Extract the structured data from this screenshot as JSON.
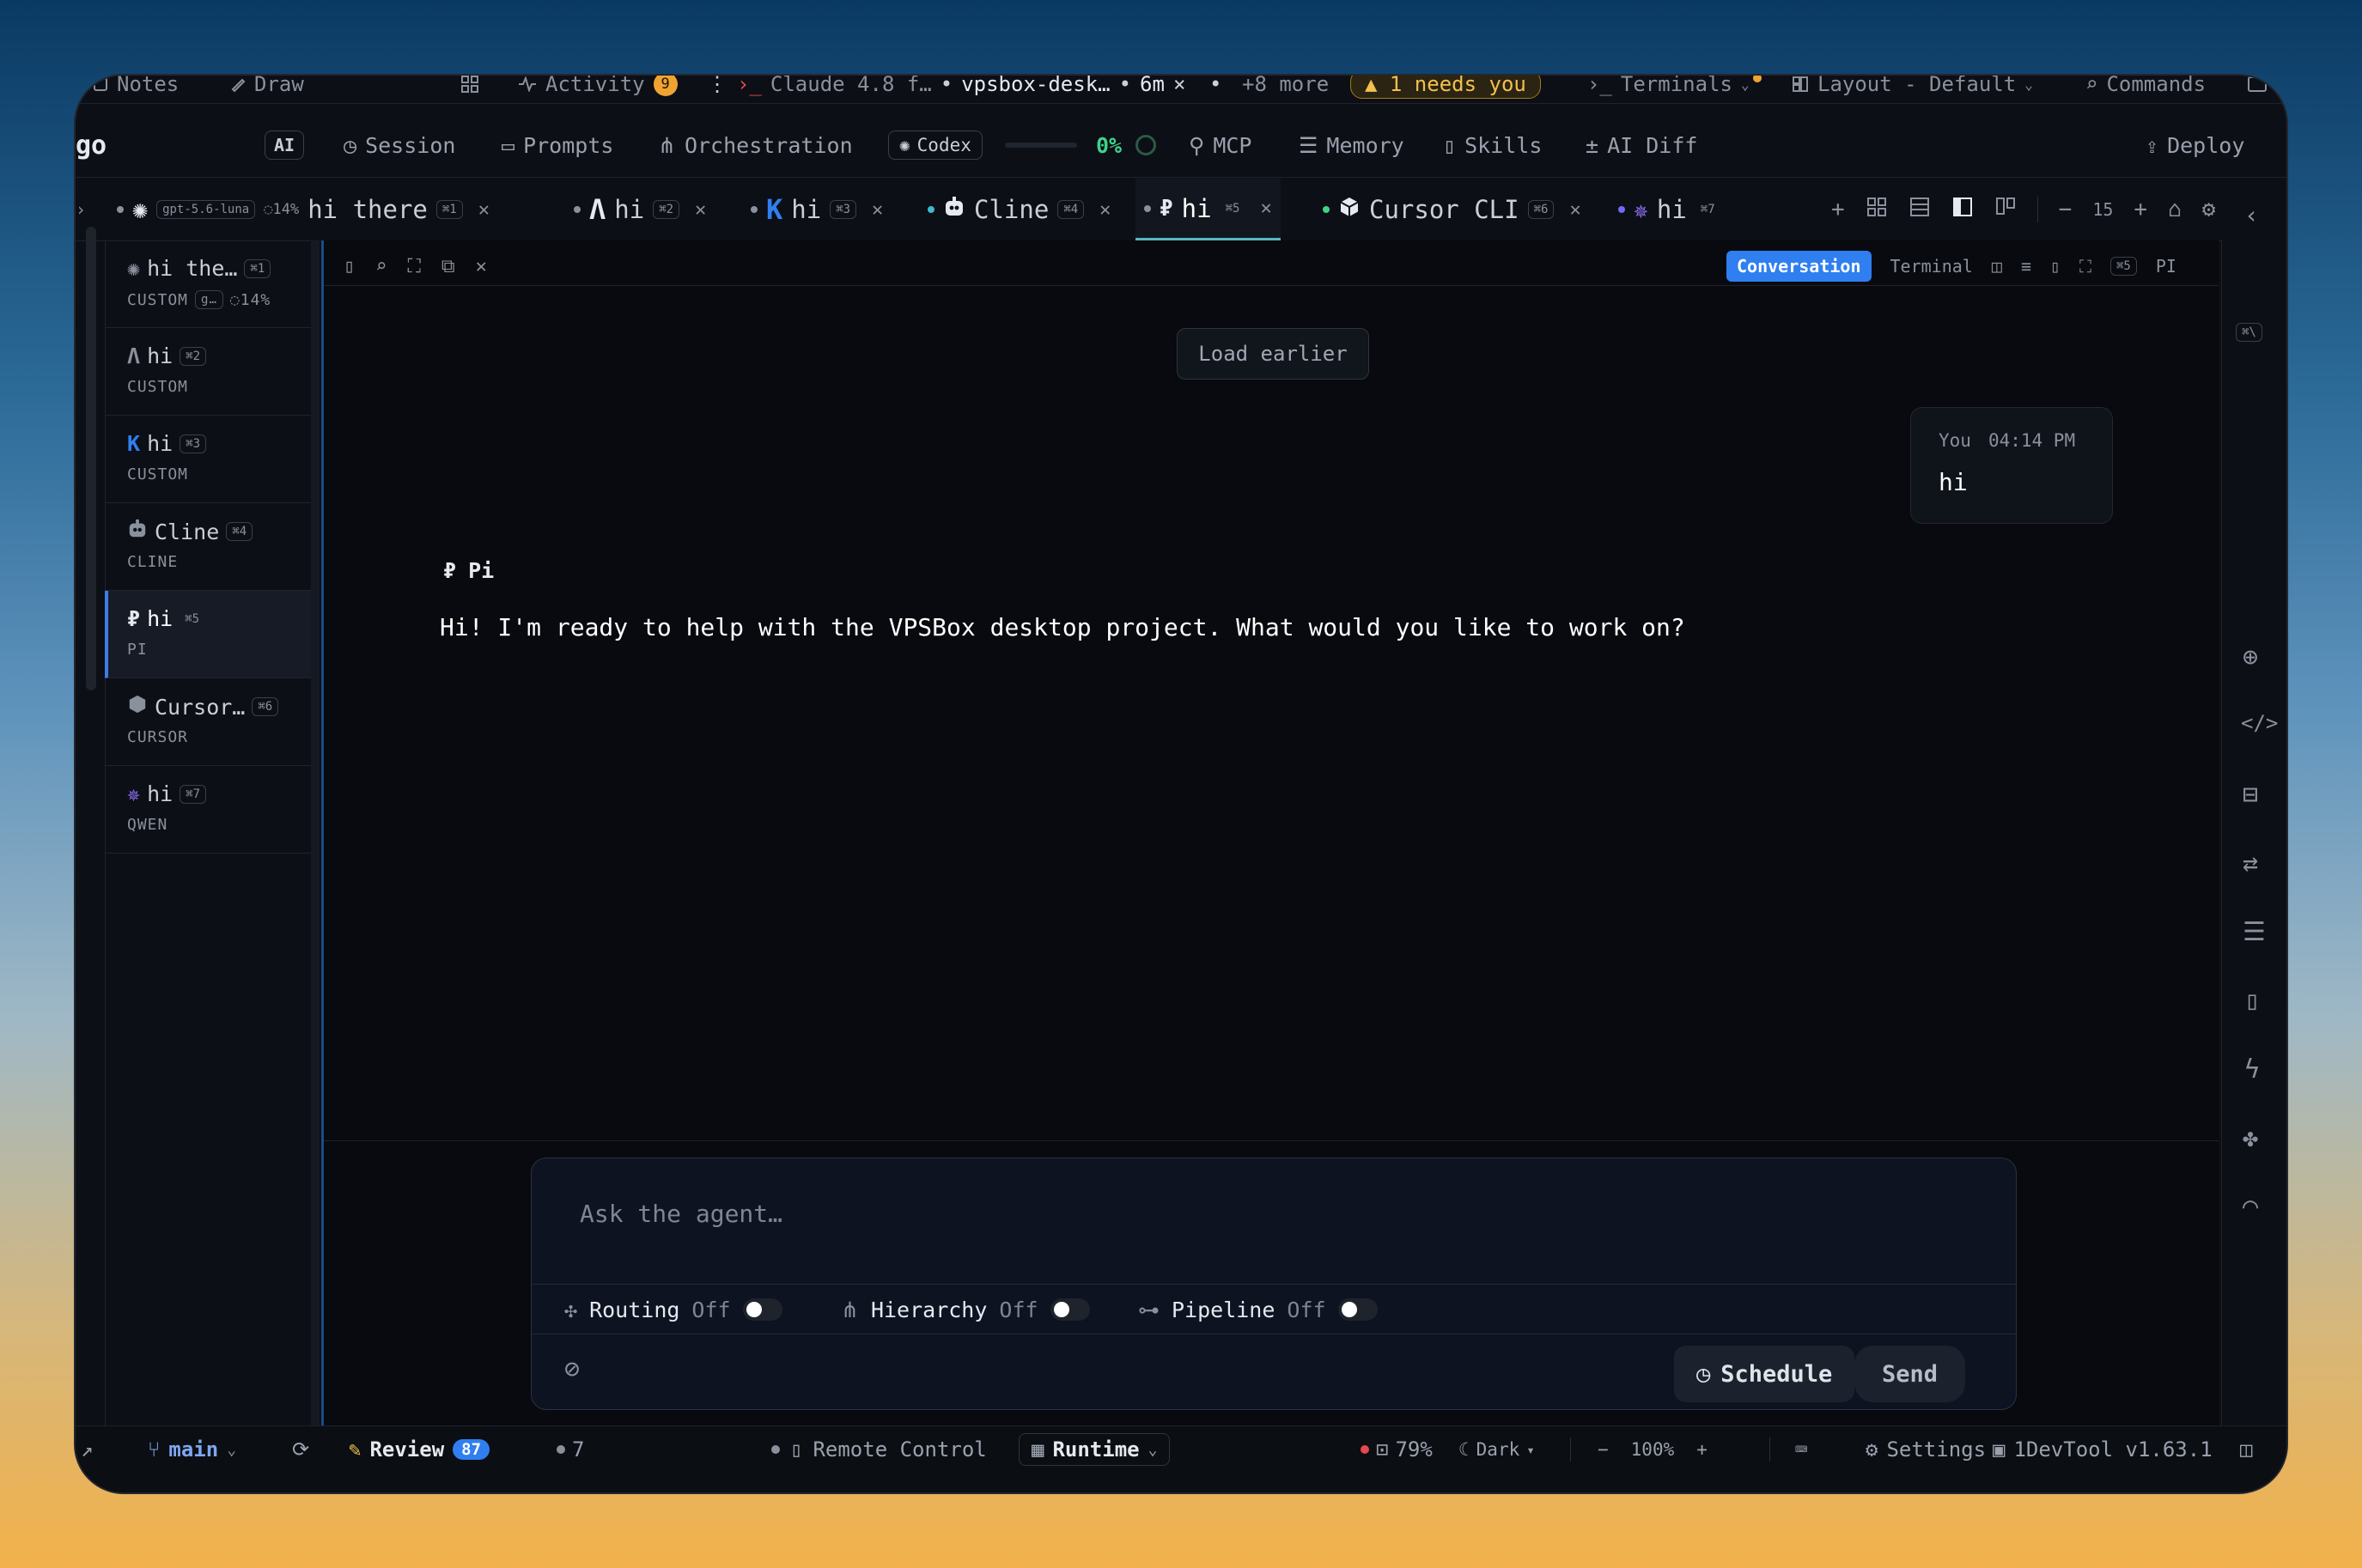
{
  "topbar": {
    "notes": "Notes",
    "draw": "Draw",
    "activity": "Activity",
    "activity_count": "9",
    "claude_session": "Claude 4.8 f…",
    "project": "vpsbox-desk…",
    "elapsed": "6m",
    "more": "+8 more",
    "needs_you": "1 needs you",
    "terminals": "Terminals",
    "layout": "Layout - Default",
    "commands": "Commands"
  },
  "nav": {
    "app_fragment": "go",
    "ai_badge": "AI",
    "session": "Session",
    "prompts": "Prompts",
    "orchestration": "Orchestration",
    "codex": "Codex",
    "progress": "0%",
    "mcp": "MCP",
    "memory": "Memory",
    "skills": "Skills",
    "ai_diff": "AI Diff",
    "deploy": "Deploy"
  },
  "tabs": [
    {
      "model": "gpt-5.6-luna",
      "progress": "14%",
      "label": "hi there",
      "shortcut": "⌘1"
    },
    {
      "label": "hi",
      "shortcut": "⌘2"
    },
    {
      "label": "hi",
      "shortcut": "⌘3"
    },
    {
      "label": "Cline",
      "shortcut": "⌘4"
    },
    {
      "label": "hi",
      "shortcut": "⌘5"
    },
    {
      "label": "Cursor CLI",
      "shortcut": "⌘6"
    },
    {
      "label": "hi",
      "shortcut": "⌘7"
    }
  ],
  "tab_controls": {
    "add": "+",
    "minus": "−",
    "font_size": "15",
    "plus": "+"
  },
  "sidebar": {
    "items": [
      {
        "title": "hi the…",
        "shortcut": "⌘1",
        "sub": "CUSTOM",
        "model": "g…",
        "progress": "14%"
      },
      {
        "title": "hi",
        "shortcut": "⌘2",
        "sub": "CUSTOM"
      },
      {
        "title": "hi",
        "shortcut": "⌘3",
        "sub": "CUSTOM"
      },
      {
        "title": "Cline",
        "shortcut": "⌘4",
        "sub": "CLINE"
      },
      {
        "title": "hi",
        "shortcut": "⌘5",
        "sub": "PI"
      },
      {
        "title": "Cursor…",
        "shortcut": "⌘6",
        "sub": "CURSOR"
      },
      {
        "title": "hi",
        "shortcut": "⌘7",
        "sub": "QWEN"
      }
    ]
  },
  "chat_toolbar": {
    "conversation": "Conversation",
    "terminal": "Terminal",
    "shortcut": "⌘5",
    "agent": "PI",
    "side_shortcut": "⌘\\"
  },
  "chat": {
    "load_earlier": "Load earlier",
    "user_name": "You",
    "user_time": "04:14 PM",
    "user_message": "hi",
    "agent_name": "Pi",
    "agent_message": "Hi! I'm ready to help with the VPSBox desktop project. What would you like to work on?"
  },
  "composer": {
    "placeholder": "Ask the agent…",
    "routing": "Routing",
    "routing_state": "Off",
    "hierarchy": "Hierarchy",
    "hierarchy_state": "Off",
    "pipeline": "Pipeline",
    "pipeline_state": "Off",
    "schedule": "Schedule",
    "send": "Send"
  },
  "statusbar": {
    "branch": "main",
    "review": "Review",
    "review_count": "87",
    "dot_count": "7",
    "remote": "Remote Control",
    "runtime": "Runtime",
    "cpu": "79%",
    "theme": "Dark",
    "zoom_minus": "−",
    "zoom": "100%",
    "zoom_plus": "+",
    "settings": "Settings",
    "version": "1DevTool v1.63.1"
  },
  "colors": {
    "accent": "#3f7be5",
    "progress_green": "#3fd38a",
    "warning": "#f2c14c",
    "red_dot": "#e5484d"
  }
}
